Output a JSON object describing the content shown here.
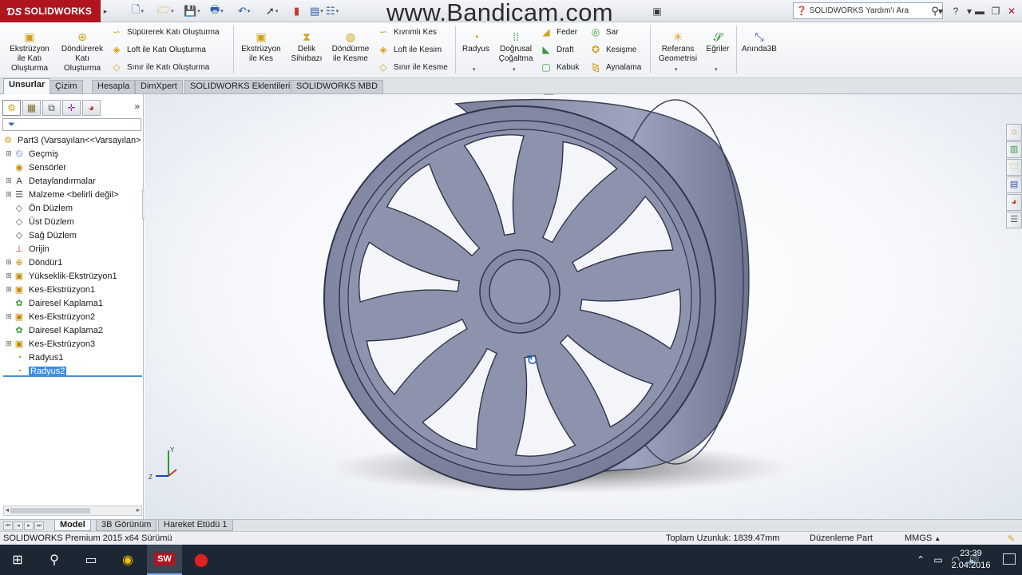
{
  "titlebar": {
    "app_name": "SOLIDWORKS",
    "watermark": "www.Bandicam.com",
    "search_placeholder": "SOLIDWORKS Yardım'ı Ara"
  },
  "command_manager": {
    "extrude_boss": "Ekstrüzyon ile Katı Oluşturma",
    "revolve_boss": "Döndürerek Katı Oluşturma",
    "swept_boss": "Süpürerek Katı Oluşturma",
    "lofted_boss": "Loft ile Katı Oluşturma",
    "boundary_boss": "Sınır ile Katı Oluşturma",
    "extrude_cut": "Ekstrüzyon ile Kes",
    "hole_wizard": "Delik Sihirbazı",
    "revolve_cut": "Döndürme ile Kesme",
    "swept_cut": "Kıvrımlı Kes",
    "lofted_cut": "Loft ile Kesim",
    "boundary_cut": "Sınır ile Kesme",
    "fillet": "Radyus",
    "linear_pattern": "Doğrusal Çoğaltma",
    "rib": "Feder",
    "draft": "Draft",
    "shell": "Kabuk",
    "wrap": "Sar",
    "intersect": "Kesişme",
    "mirror": "Aynalama",
    "reference_geometry": "Referans Geometrisi",
    "curves": "Eğriler",
    "instant3d": "Anında3B"
  },
  "tabs": [
    "Unsurlar",
    "Çizim",
    "Hesapla",
    "DimXpert",
    "SOLIDWORKS Eklentileri",
    "SOLIDWORKS MBD"
  ],
  "feature_tree": {
    "filter_icon": "funnel-icon",
    "root": "Part3  (Varsayılan<<Varsayılan>",
    "items": [
      {
        "label": "Geçmiş",
        "expandable": true,
        "icon": "history-icon"
      },
      {
        "label": "Sensörler",
        "expandable": false,
        "icon": "sensor-icon"
      },
      {
        "label": "Detaylandırmalar",
        "expandable": true,
        "icon": "annotation-icon"
      },
      {
        "label": "Malzeme <belirli değil>",
        "expandable": true,
        "icon": "material-icon"
      },
      {
        "label": "Ön Düzlem",
        "expandable": false,
        "icon": "plane-icon"
      },
      {
        "label": "Üst Düzlem",
        "expandable": false,
        "icon": "plane-icon"
      },
      {
        "label": "Sağ Düzlem",
        "expandable": false,
        "icon": "plane-icon"
      },
      {
        "label": "Orijin",
        "expandable": false,
        "icon": "origin-icon"
      },
      {
        "label": "Döndür1",
        "expandable": true,
        "icon": "revolve-icon"
      },
      {
        "label": "Yükseklik-Ekstrüzyon1",
        "expandable": true,
        "icon": "extrude-icon"
      },
      {
        "label": "Kes-Ekstrüzyon1",
        "expandable": true,
        "icon": "cut-extrude-icon"
      },
      {
        "label": "Dairesel Kaplama1",
        "expandable": false,
        "icon": "circular-pattern-icon"
      },
      {
        "label": "Kes-Ekstrüzyon2",
        "expandable": true,
        "icon": "cut-extrude-icon"
      },
      {
        "label": "Dairesel Kaplama2",
        "expandable": false,
        "icon": "circular-pattern-icon"
      },
      {
        "label": "Kes-Ekstrüzyon3",
        "expandable": true,
        "icon": "cut-extrude-icon"
      },
      {
        "label": "Radyus1",
        "expandable": false,
        "icon": "fillet-icon"
      },
      {
        "label": "Radyus2",
        "expandable": false,
        "icon": "fillet-icon",
        "selected": true
      }
    ]
  },
  "bottom_tabs": [
    "Model",
    "3B Görünüm",
    "Hareket Etüdü 1"
  ],
  "statusbar": {
    "version": "SOLIDWORKS Premium 2015 x64 Sürümü",
    "total_length": "Toplam Uzunluk: 1839.47mm",
    "mode": "Düzenleme Part",
    "units": "MMGS"
  },
  "taskbar": {
    "time": "23:39",
    "date": "2.04.2016"
  },
  "colors": {
    "brand": "#b0151f",
    "wheel": "#8d93ad",
    "selection": "#3a8ee6"
  }
}
